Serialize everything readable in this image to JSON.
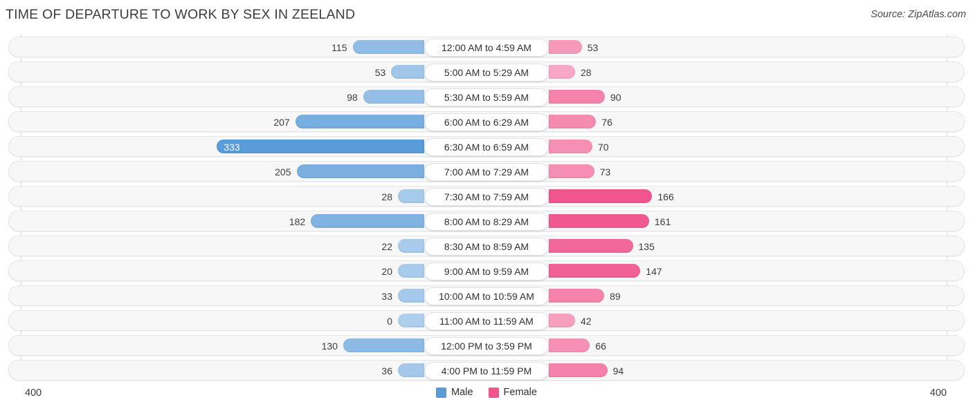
{
  "header": {
    "title": "TIME OF DEPARTURE TO WORK BY SEX IN ZEELAND",
    "source": "Source: ZipAtlas.com"
  },
  "axis": {
    "left_label": "400",
    "right_label": "400",
    "max": 400
  },
  "legend": [
    {
      "label": "Male",
      "color": "#5b9bd5"
    },
    {
      "label": "Female",
      "color": "#f0568d"
    }
  ],
  "chart_data": {
    "type": "bar",
    "subtype": "diverging-horizontal",
    "title": "TIME OF DEPARTURE TO WORK BY SEX IN ZEELAND",
    "xlabel": "",
    "ylabel": "",
    "xlim": [
      400,
      400
    ],
    "grid": false,
    "legend_position": "bottom-center",
    "categories": [
      "12:00 AM to 4:59 AM",
      "5:00 AM to 5:29 AM",
      "5:30 AM to 5:59 AM",
      "6:00 AM to 6:29 AM",
      "6:30 AM to 6:59 AM",
      "7:00 AM to 7:29 AM",
      "7:30 AM to 7:59 AM",
      "8:00 AM to 8:29 AM",
      "8:30 AM to 8:59 AM",
      "9:00 AM to 9:59 AM",
      "10:00 AM to 10:59 AM",
      "11:00 AM to 11:59 AM",
      "12:00 PM to 3:59 PM",
      "4:00 PM to 11:59 PM"
    ],
    "series": [
      {
        "name": "Male",
        "direction": "left",
        "color": "#5b9bd5",
        "values": [
          115,
          53,
          98,
          207,
          333,
          205,
          28,
          182,
          22,
          20,
          33,
          0,
          130,
          36
        ]
      },
      {
        "name": "Female",
        "direction": "right",
        "color": "#f0568d",
        "values": [
          53,
          28,
          90,
          76,
          70,
          73,
          166,
          161,
          135,
          147,
          89,
          42,
          66,
          94
        ]
      }
    ]
  }
}
